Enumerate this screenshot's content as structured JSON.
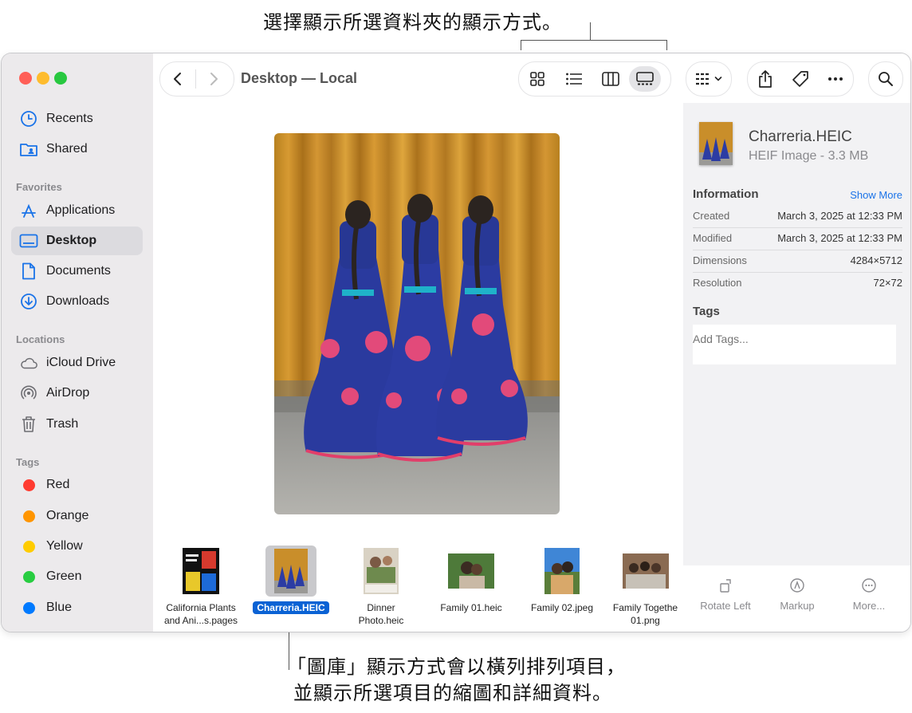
{
  "callouts": {
    "top": "選擇顯示所選資料夾的顯示方式。",
    "bottom_line1": "「圖庫」顯示方式會以橫列排列項目，",
    "bottom_line2": "並顯示所選項目的縮圖和詳細資料。"
  },
  "window": {
    "title": "Desktop — Local"
  },
  "sidebar": {
    "items_top": [
      {
        "label": "Recents",
        "icon": "clock-icon"
      },
      {
        "label": "Shared",
        "icon": "shared-folder-icon"
      }
    ],
    "favorites_title": "Favorites",
    "favorites": [
      {
        "label": "Applications",
        "icon": "applications-icon"
      },
      {
        "label": "Desktop",
        "icon": "desktop-icon",
        "selected": true
      },
      {
        "label": "Documents",
        "icon": "document-icon"
      },
      {
        "label": "Downloads",
        "icon": "download-icon"
      }
    ],
    "locations_title": "Locations",
    "locations": [
      {
        "label": "iCloud Drive",
        "icon": "cloud-icon"
      },
      {
        "label": "AirDrop",
        "icon": "airdrop-icon"
      },
      {
        "label": "Trash",
        "icon": "trash-icon"
      }
    ],
    "tags_title": "Tags",
    "tags": [
      {
        "label": "Red",
        "color": "#ff3b30"
      },
      {
        "label": "Orange",
        "color": "#ff9500"
      },
      {
        "label": "Yellow",
        "color": "#ffcc00"
      },
      {
        "label": "Green",
        "color": "#28cd41"
      },
      {
        "label": "Blue",
        "color": "#007aff"
      }
    ]
  },
  "files": [
    {
      "name_line1": "California Plants",
      "name_line2": "and Ani...s.pages",
      "selected": false
    },
    {
      "name_line1": "Charreria.HEIC",
      "name_line2": "",
      "selected": true
    },
    {
      "name_line1": "Dinner",
      "name_line2": "Photo.heic",
      "selected": false
    },
    {
      "name_line1": "Family 01.heic",
      "name_line2": "",
      "selected": false
    },
    {
      "name_line1": "Family 02.jpeg",
      "name_line2": "",
      "selected": false
    },
    {
      "name_line1": "Family Togethe",
      "name_line2": "01.png",
      "selected": false
    }
  ],
  "inspector": {
    "file_name": "Charreria.HEIC",
    "file_kind": "HEIF Image - 3.3 MB",
    "info_title": "Information",
    "show_more": "Show More",
    "rows": [
      {
        "label": "Created",
        "value": "March 3, 2025 at 12:33 PM"
      },
      {
        "label": "Modified",
        "value": "March 3, 2025 at 12:33 PM"
      },
      {
        "label": "Dimensions",
        "value": "4284×5712"
      },
      {
        "label": "Resolution",
        "value": "72×72"
      }
    ],
    "tags_title": "Tags",
    "tags_placeholder": "Add Tags...",
    "actions": [
      {
        "label": "Rotate Left",
        "icon": "rotate-left-icon"
      },
      {
        "label": "Markup",
        "icon": "markup-icon"
      },
      {
        "label": "More...",
        "icon": "more-circle-icon"
      }
    ]
  },
  "colors": {
    "accent": "#0a62d4",
    "sidebar_bg": "#eceaec",
    "link": "#1a73e8"
  }
}
